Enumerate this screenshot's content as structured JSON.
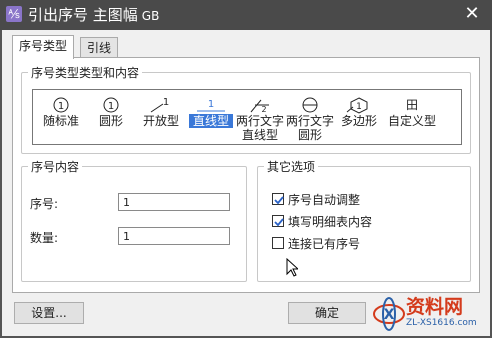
{
  "window": {
    "title": "引出序号 主图幅",
    "standard": "GB",
    "close_glyph": "✕",
    "app_glyph": "⅍"
  },
  "tabs": [
    {
      "label": "序号类型",
      "active": true
    },
    {
      "label": "引线",
      "active": false
    }
  ],
  "type_group": {
    "title": "序号类型类型和内容",
    "items": [
      {
        "label": "随标准",
        "label2": "",
        "symbol": "1"
      },
      {
        "label": "圆形",
        "label2": "",
        "symbol": "1"
      },
      {
        "label": "开放型",
        "label2": "",
        "symbol": "1"
      },
      {
        "label": "直线型",
        "label2": "",
        "symbol": "1",
        "selected": true
      },
      {
        "label": "两行文字",
        "label2": "直线型",
        "symbol": "1/2"
      },
      {
        "label": "两行文字",
        "label2": "圆形",
        "symbol": "⊖"
      },
      {
        "label": "多边形",
        "label2": "",
        "symbol": "1"
      },
      {
        "label": "自定义型",
        "label2": "",
        "symbol": "田"
      }
    ]
  },
  "content_group": {
    "title": "序号内容",
    "serial_label": "序号:",
    "serial_value": "1",
    "qty_label": "数量:",
    "qty_value": "1"
  },
  "other_group": {
    "title": "其它选项",
    "options": [
      {
        "label": "序号自动调整",
        "checked": true
      },
      {
        "label": "填写明细表内容",
        "checked": true
      },
      {
        "label": "连接已有序号",
        "checked": false
      }
    ]
  },
  "buttons": {
    "settings": "设置...",
    "ok": "确定"
  },
  "watermark": {
    "text": "资料网",
    "url": "ZL-XS1616.com"
  },
  "colors": {
    "titlebar": "#4a4a4a",
    "selection": "#3a78d8",
    "watermark_red": "#d43b1c"
  }
}
